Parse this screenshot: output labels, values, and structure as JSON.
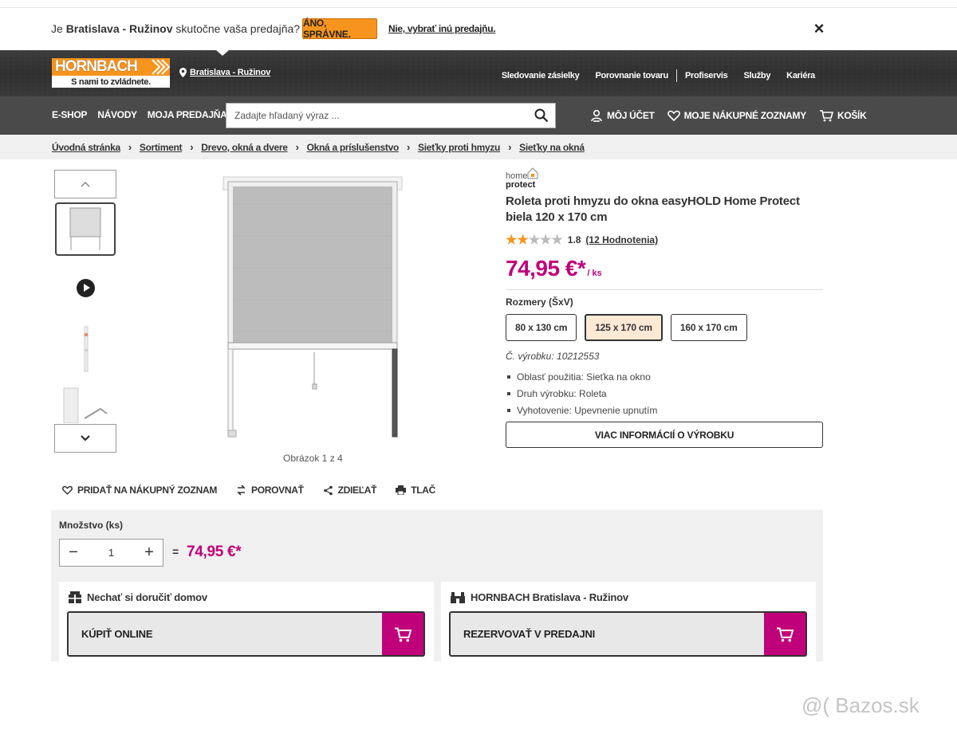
{
  "store_banner": {
    "question_prefix": "Je ",
    "store_name": "Bratislava - Ružinov",
    "question_suffix": " skutočne vaša predajňa?",
    "confirm_label": "ÁNO, SPRÁVNE.",
    "change_label": "Nie, vybrať inú predajňu.",
    "close_icon": "×"
  },
  "header": {
    "logo_text": "HORNBACH",
    "logo_tagline": "S nami to zvládnete.",
    "store_label": "Bratislava - Ružinov",
    "top_links": [
      "Sledovanie zásielky",
      "Porovnanie tovaru",
      "Profiservis",
      "Služby",
      "Kariéra"
    ]
  },
  "nav": {
    "menu": [
      "E-SHOP",
      "NÁVODY",
      "MOJA PREDAJŇA"
    ],
    "search_placeholder": "Zadajte hľadaný výraz ...",
    "account": "MÔJ ÚČET",
    "lists": "MOJE NÁKUPNÉ ZOZNAMY",
    "cart": "KOŠÍK"
  },
  "breadcrumb": [
    "Úvodná stránka",
    "Sortiment",
    "Drevo, okná a dvere",
    "Okná a príslušenstvo",
    "Sieťky proti hmyzu",
    "Sieťky na okná"
  ],
  "gallery": {
    "counter": "Obrázok 1 z 4"
  },
  "actions": {
    "add_to_list": "PRIDAŤ NA NÁKUPNÝ ZOZNAM",
    "compare": "POROVNAŤ",
    "share": "ZDIEĽAŤ",
    "print": "TLAČ"
  },
  "product": {
    "brand_line1": "home",
    "brand_line2": "protect",
    "title": "Roleta proti hmyzu do okna easyHOLD Home Protect biela 120 x 170 cm",
    "rating_value": "1.8",
    "rating_stars": 1.8,
    "rating_count": "(12 Hodnotenia)",
    "price": "74,95 €*",
    "unit": "/ ks",
    "size_label": "Rozmery (ŠxV)",
    "sizes": [
      {
        "label": "80 x 130 cm",
        "selected": false
      },
      {
        "label": "125 x 170 cm",
        "selected": true
      },
      {
        "label": "160 x 170 cm",
        "selected": false
      }
    ],
    "article_no": "Č. výrobku: 10212553",
    "features": [
      "Oblasť použitia: Sieťka na okno",
      "Druh výrobku: Roleta",
      "Vyhotovenie: Upevnenie upnutím"
    ],
    "more_info": "VIAC INFORMÁCIÍ O VÝROBKU"
  },
  "buy": {
    "qty_label": "Množstvo (ks)",
    "qty_value": "1",
    "minus": "−",
    "plus": "+",
    "equals": "=",
    "total": "74,95 €*",
    "delivery_title": "Nechať si doručiť domov",
    "delivery_button": "KÚPIŤ ONLINE",
    "store_title": "HORNBACH Bratislava - Ružinov",
    "store_button": "REZERVOVAŤ V PREDAJNI"
  },
  "watermark": "@( Bazos.sk",
  "colors": {
    "brand_orange": "#f7941d",
    "price_magenta": "#c0007a",
    "header_dark": "#333333",
    "nav_gray": "#4a4a4a"
  }
}
